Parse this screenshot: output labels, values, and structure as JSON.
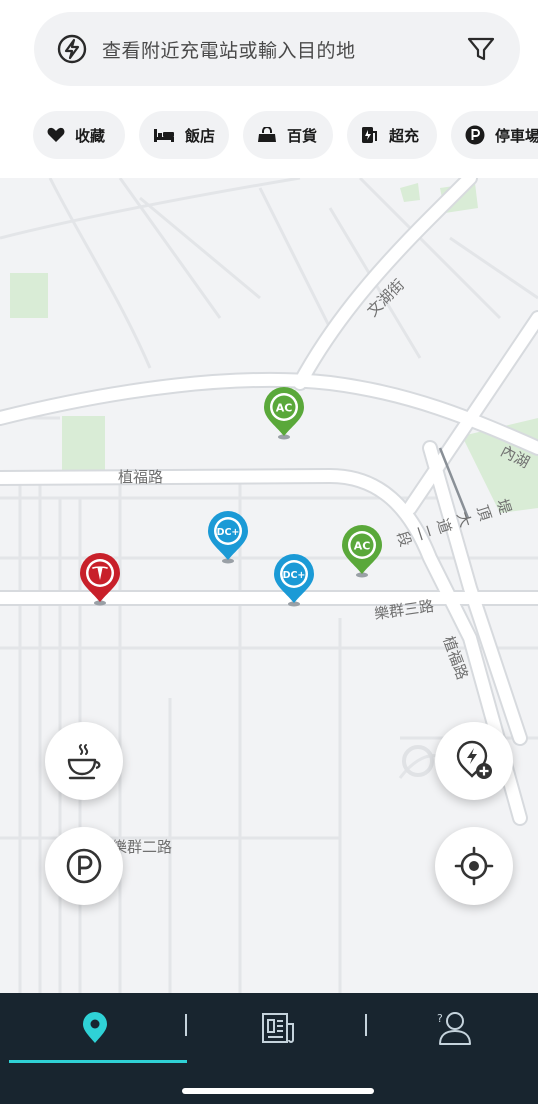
{
  "search": {
    "placeholder": "查看附近充電站或輸入目的地"
  },
  "chips": [
    {
      "label": "收藏",
      "icon": "heart-icon"
    },
    {
      "label": "飯店",
      "icon": "bed-icon"
    },
    {
      "label": "百貨",
      "icon": "shopping-bag-icon"
    },
    {
      "label": "超充",
      "icon": "supercharger-icon"
    },
    {
      "label": "停車場",
      "icon": "parking-icon"
    }
  ],
  "map": {
    "street_labels": [
      "文湖街",
      "植福路",
      "樂群三路",
      "植福路",
      "堤頂大道二段",
      "內湖",
      "樂群二路"
    ],
    "markers": [
      {
        "type": "AC",
        "color": "#5aa83a"
      },
      {
        "type": "DC+",
        "color": "#1b9ad6"
      },
      {
        "type": "DC+",
        "color": "#1b9ad6"
      },
      {
        "type": "AC",
        "color": "#5aa83a"
      },
      {
        "type": "Tesla",
        "color": "#c8202a"
      }
    ],
    "buttons": [
      {
        "name": "cafe",
        "icon": "coffee-cup-icon"
      },
      {
        "name": "parking",
        "icon": "parking-icon"
      },
      {
        "name": "add-charger",
        "icon": "add-charger-icon"
      },
      {
        "name": "locate",
        "icon": "crosshair-icon"
      }
    ]
  },
  "nav": {
    "items": [
      {
        "name": "map",
        "icon": "map-pin-icon",
        "active": true
      },
      {
        "name": "news",
        "icon": "news-icon",
        "active": false
      },
      {
        "name": "account",
        "icon": "user-help-icon",
        "active": false
      }
    ],
    "accent": "#2fd2d6",
    "background": "#18252f"
  }
}
